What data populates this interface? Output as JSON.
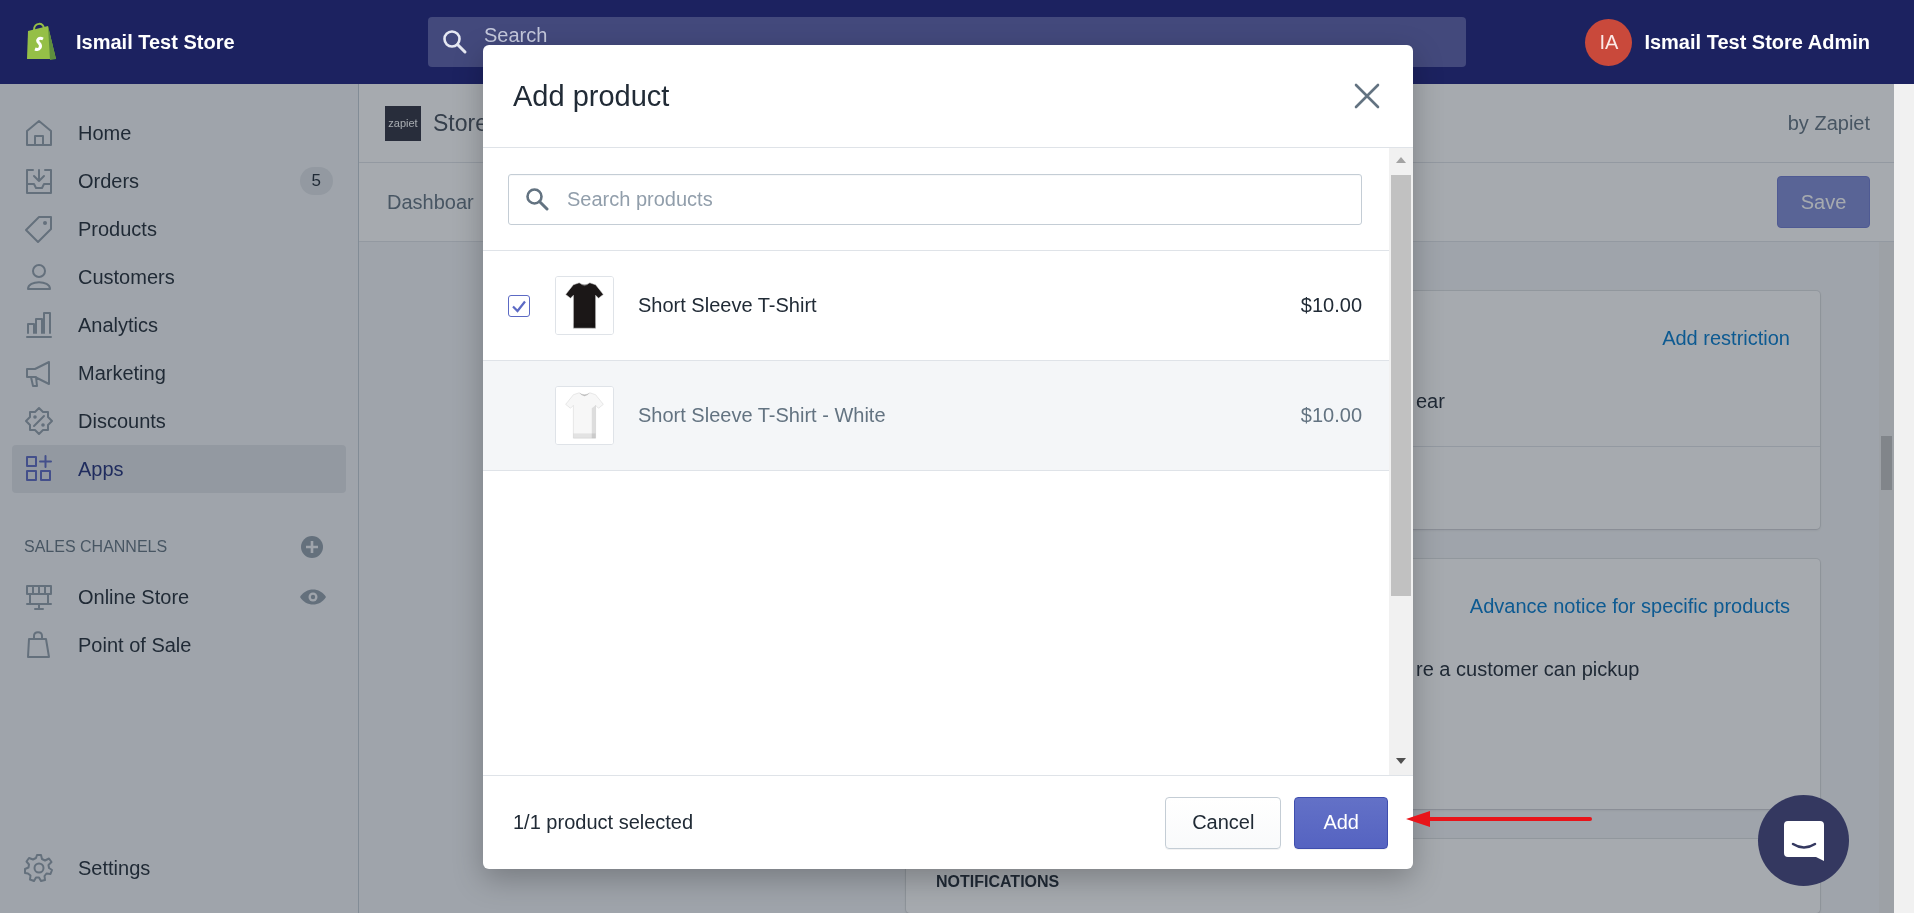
{
  "top_bar": {
    "store_name": "Ismail Test Store",
    "search": {
      "placeholder": "Search"
    },
    "account": {
      "initials": "IA",
      "name": "Ismail Test Store Admin"
    }
  },
  "sidebar": {
    "items": [
      {
        "label": "Home",
        "selected": false
      },
      {
        "label": "Orders",
        "selected": false,
        "badge": "5"
      },
      {
        "label": "Products",
        "selected": false
      },
      {
        "label": "Customers",
        "selected": false
      },
      {
        "label": "Analytics",
        "selected": false
      },
      {
        "label": "Marketing",
        "selected": false
      },
      {
        "label": "Discounts",
        "selected": false
      },
      {
        "label": "Apps",
        "selected": true
      }
    ],
    "sales_channels": {
      "title": "SALES CHANNELS",
      "items": [
        {
          "label": "Online Store"
        },
        {
          "label": "Point of Sale"
        }
      ]
    },
    "settings": "Settings"
  },
  "app_header": {
    "logo": "zapiet",
    "title": "Store",
    "byline": "by Zapiet",
    "tab": "Dashboar",
    "save_button": {
      "label": "Save",
      "disabled": true
    }
  },
  "cards": [
    {
      "link": "Add restriction",
      "text": "ear"
    },
    {
      "link": "Advance notice for specific products",
      "text": "re a customer can pickup"
    },
    {
      "heading": "NOTIFICATIONS"
    }
  ],
  "modal": {
    "title": "Add product",
    "search": {
      "placeholder": "Search products"
    },
    "products": [
      {
        "kind": "product",
        "name": "Short Sleeve T-Shirt",
        "price": "$10.00",
        "checked": true
      },
      {
        "kind": "variant",
        "name": "Short Sleeve T-Shirt - White",
        "price": "$10.00"
      }
    ],
    "footer": {
      "status": "1/1 product selected",
      "buttons": [
        {
          "label": "Cancel",
          "kind": "secondary"
        },
        {
          "label": "Add",
          "kind": "primary"
        }
      ]
    }
  }
}
